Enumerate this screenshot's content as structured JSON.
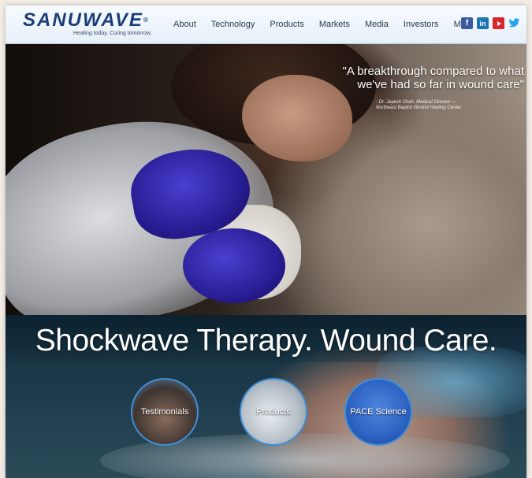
{
  "header": {
    "logo_text": "SANUWAVE",
    "logo_mark": "®",
    "tagline": "Healing today. Curing tomorrow.",
    "nav": [
      "About",
      "Technology",
      "Products",
      "Markets",
      "Media",
      "Investors",
      "More"
    ],
    "social": [
      {
        "icon": "facebook-icon",
        "glyph": "f"
      },
      {
        "icon": "linkedin-icon",
        "glyph": "in"
      },
      {
        "icon": "youtube-icon",
        "glyph": "▶"
      },
      {
        "icon": "twitter-icon",
        "glyph": "🐦"
      }
    ]
  },
  "hero": {
    "quote": "\"A breakthrough compared  to what we've had so far in wound care\"",
    "attribution_line1": "- Dr. Jayesh Shah, Medical Director —",
    "attribution_line2": "Northeast Baptist Wound Healing Center"
  },
  "lower": {
    "headline": "Shockwave Therapy.  Wound Care.",
    "circles": [
      {
        "label": "Testimonials"
      },
      {
        "label": "Products"
      },
      {
        "label": "PACE Science"
      }
    ]
  },
  "colors": {
    "brand": "#1c3e78",
    "circle_border": "#3f8fd8",
    "facebook": "#3b5aa0",
    "linkedin": "#1a75b2",
    "youtube": "#d9262a",
    "twitter": "#2aa3ef"
  }
}
